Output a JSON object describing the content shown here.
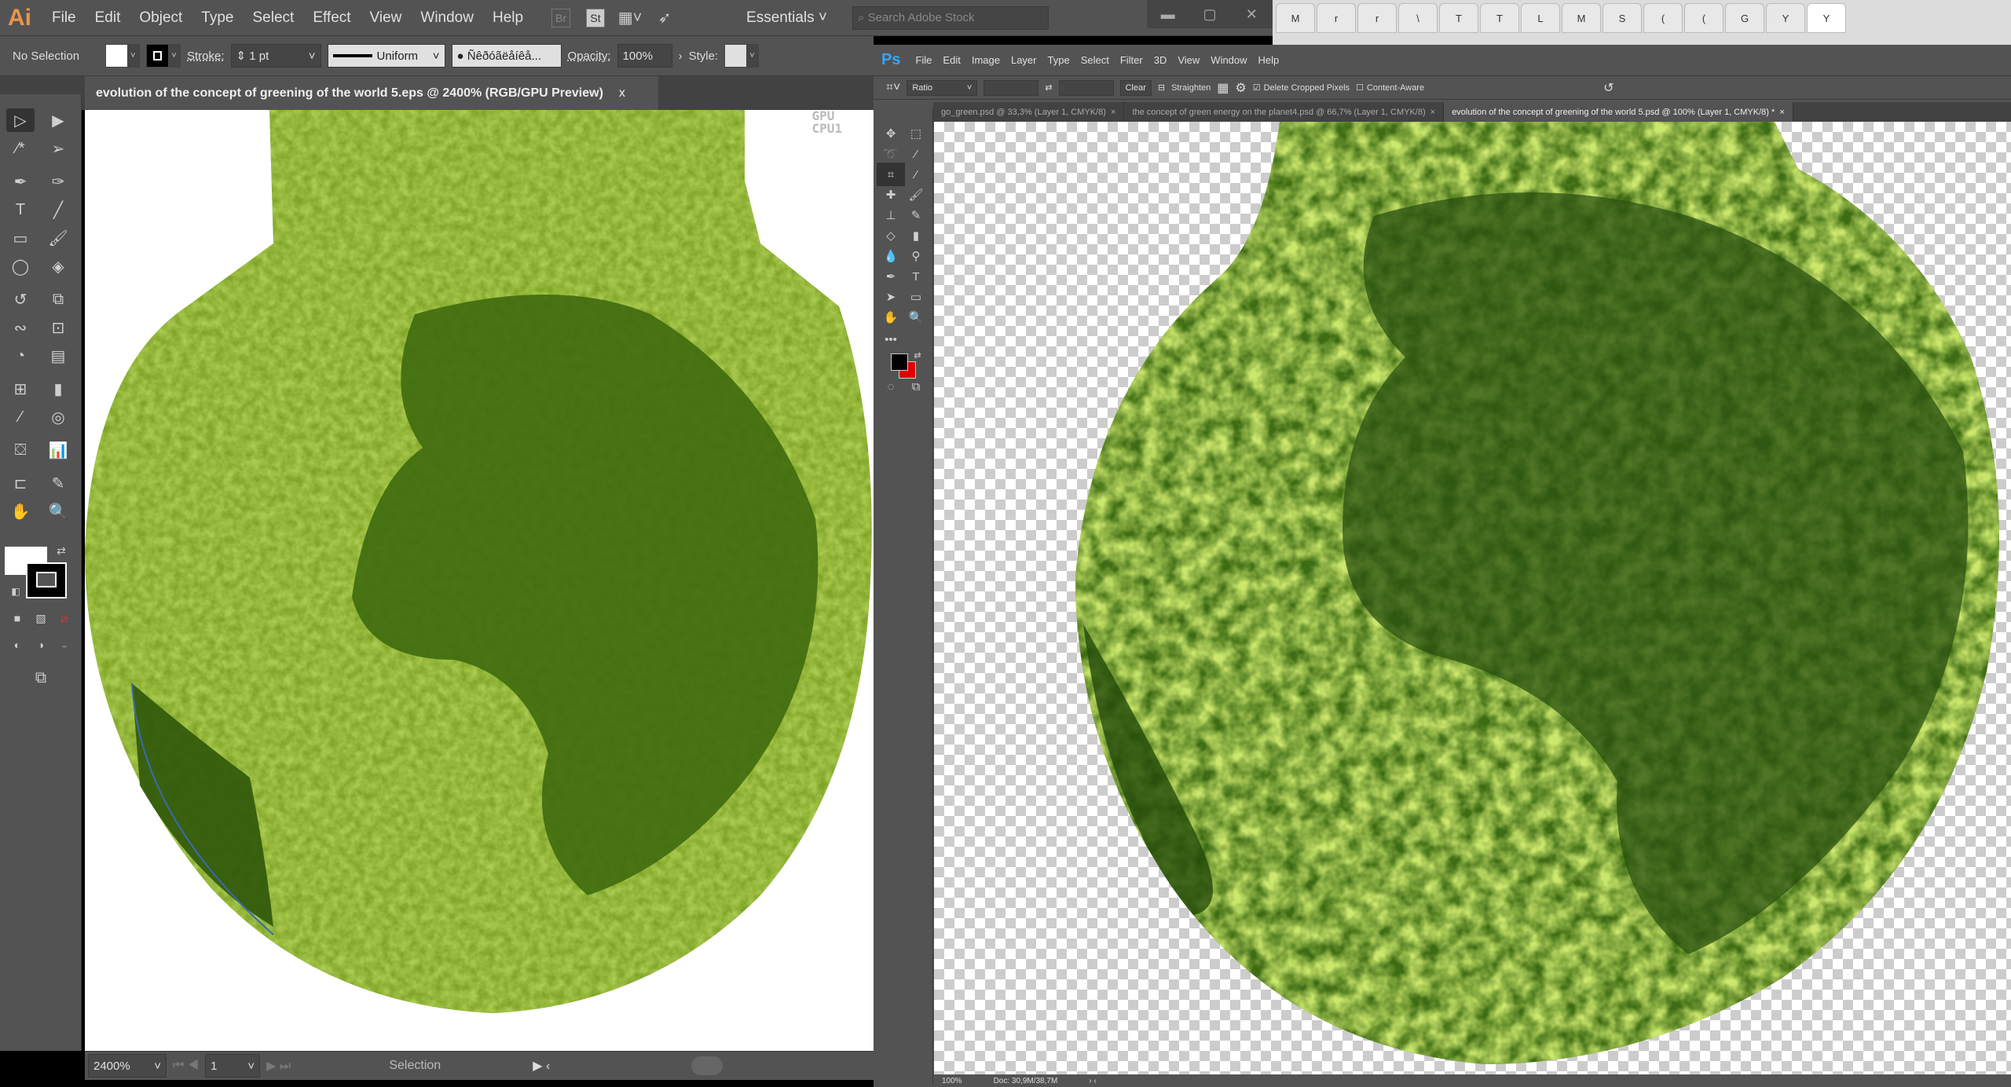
{
  "illustrator": {
    "logo": "Ai",
    "menu": [
      "File",
      "Edit",
      "Object",
      "Type",
      "Select",
      "Effect",
      "View",
      "Window",
      "Help"
    ],
    "app_buttons": [
      "Br",
      "St"
    ],
    "workspace": "Essentials",
    "search_placeholder": "Search Adobe Stock",
    "control": {
      "selection": "No Selection",
      "stroke_label": "Stroke:",
      "stroke_value": "1 pt",
      "profile": "Uniform",
      "brush": "Ñêðóãëåíêå...",
      "opacity_label": "Opacity:",
      "opacity_value": "100%",
      "style_label": "Style:"
    },
    "document_tab": "evolution of the concept of greening of the world 5.eps @ 2400% (RGB/GPU Preview)",
    "close": "x",
    "gpu_label": "GPU",
    "cpu_label": "CPU1",
    "status": {
      "zoom": "2400%",
      "artboard": "1",
      "tool": "Selection"
    }
  },
  "browser": {
    "tabs": [
      "M",
      "r",
      "r",
      "\\",
      "T",
      "T",
      "L",
      "M",
      "S",
      "(",
      "(",
      "G",
      "Y",
      "Y"
    ]
  },
  "photoshop": {
    "logo": "Ps",
    "menu": [
      "File",
      "Edit",
      "Image",
      "Layer",
      "Type",
      "Select",
      "Filter",
      "3D",
      "View",
      "Window",
      "Help"
    ],
    "options": {
      "ratio": "Ratio",
      "clear": "Clear",
      "straighten": "Straighten",
      "delete_cropped": "Delete Cropped Pixels",
      "delete_cropped_checked": true,
      "content_aware": "Content-Aware",
      "content_aware_checked": false
    },
    "tabs": [
      {
        "label": "go_green.psd @ 33,3% (Layer 1, CMYK/8)",
        "active": false
      },
      {
        "label": "the concept of green energy on  the planet4.psd @ 66,7% (Layer 1, CMYK/8)",
        "active": false
      },
      {
        "label": "evolution of the concept of greening of the world 5.psd @ 100% (Layer 1, CMYK/8) *",
        "active": true
      }
    ],
    "status": {
      "zoom": "100%",
      "doc": "Doc: 30,9M/38,7M"
    },
    "colors": {
      "foreground": "#000000",
      "background": "#e00000"
    }
  }
}
